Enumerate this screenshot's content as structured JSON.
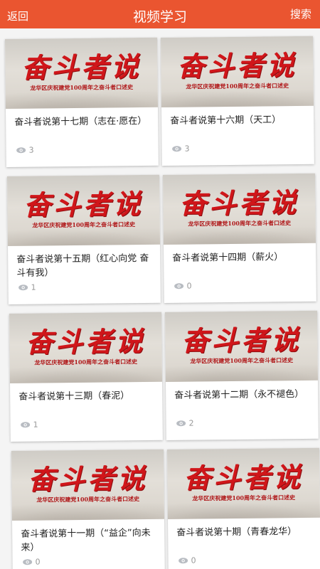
{
  "header": {
    "back_label": "返回",
    "title": "视频学习",
    "search_label": "搜索",
    "accent_color": "#ea5530"
  },
  "thumbnail": {
    "title": "奋斗者说",
    "subtitle": "龙华区庆祝建党100周年之奋斗者口述史"
  },
  "videos": [
    {
      "title": "奋斗者说第十七期（志在·愿在）",
      "views": "3"
    },
    {
      "title": "奋斗者说第十六期（天工）",
      "views": "3"
    },
    {
      "title": "奋斗者说第十五期（红心向党 奋斗有我）",
      "views": "1"
    },
    {
      "title": "奋斗者说第十四期（薪火）",
      "views": "0"
    },
    {
      "title": "奋斗者说第十三期（春泥）",
      "views": "1"
    },
    {
      "title": "奋斗者说第十二期（永不褪色）",
      "views": "2"
    },
    {
      "title": "奋斗者说第十一期（“益企”向未来）",
      "views": "0"
    },
    {
      "title": "奋斗者说第十期（青春龙华）",
      "views": "0"
    }
  ]
}
